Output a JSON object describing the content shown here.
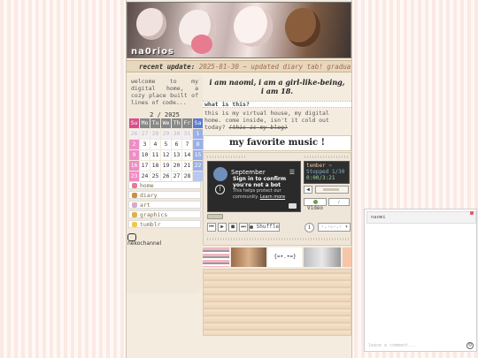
{
  "site": {
    "name": "na0rios",
    "ticker_label": "recent update:",
    "ticker_text": "2025-01-30 ~ updated diary tab! gradual site"
  },
  "sidebar": {
    "welcome": "welcome to my digital home, a cozy place built of lines of code...",
    "calendar": {
      "title": "2 / 2025",
      "weekdays": [
        "Su",
        "Mo",
        "Tu",
        "We",
        "Th",
        "Fr",
        "Sa"
      ],
      "rows": [
        [
          "26",
          "27",
          "28",
          "29",
          "30",
          "31",
          "1"
        ],
        [
          "2",
          "3",
          "4",
          "5",
          "6",
          "7",
          "8"
        ],
        [
          "9",
          "10",
          "11",
          "12",
          "13",
          "14",
          "15"
        ],
        [
          "16",
          "17",
          "18",
          "19",
          "20",
          "21",
          "22"
        ],
        [
          "23",
          "24",
          "25",
          "26",
          "27",
          "28",
          ""
        ]
      ]
    },
    "nav": [
      {
        "label": "home",
        "icon": "house-icon",
        "color": "#e77b8f"
      },
      {
        "label": "diary",
        "icon": "notebook-icon",
        "color": "#c8903e"
      },
      {
        "label": "art",
        "icon": "palette-icon",
        "color": "#d9a9c8"
      },
      {
        "label": "graphics",
        "icon": "sparkle-icon",
        "color": "#e0b04a"
      },
      {
        "label": "tumblr",
        "icon": "star-icon",
        "color": "#f0c84a"
      }
    ],
    "badge": "nekochannel"
  },
  "main": {
    "intro_line1": "i am naomi, i am a girl-like-being,",
    "intro_line2": "i am 18.",
    "what_heading": "what is this?",
    "what_body": "this is my virtual house, my digital home. come inside, isn't it cold out today?",
    "what_strike": "(this is my blog)",
    "music_title": "my favorite music !"
  },
  "player": {
    "video_title": "September",
    "video_msg_title": "Sign in to confirm you're not a bot",
    "video_msg_body": "This helps protect our community.",
    "video_msg_link": "Learn more",
    "now_playing_song": "tember ~",
    "now_playing_status": "Stopped 1/30",
    "now_playing_time": "0:00/3:21",
    "video_toggle": "Video",
    "shuffle_label": "Shuffle",
    "info_label": "i",
    "select_value": "·.·☆·.·",
    "colors": {
      "accent": "#2e2e2e",
      "wood": "#efd9bf"
    }
  },
  "widget": {
    "header": "naomi",
    "input_placeholder": "leave a comment..."
  }
}
